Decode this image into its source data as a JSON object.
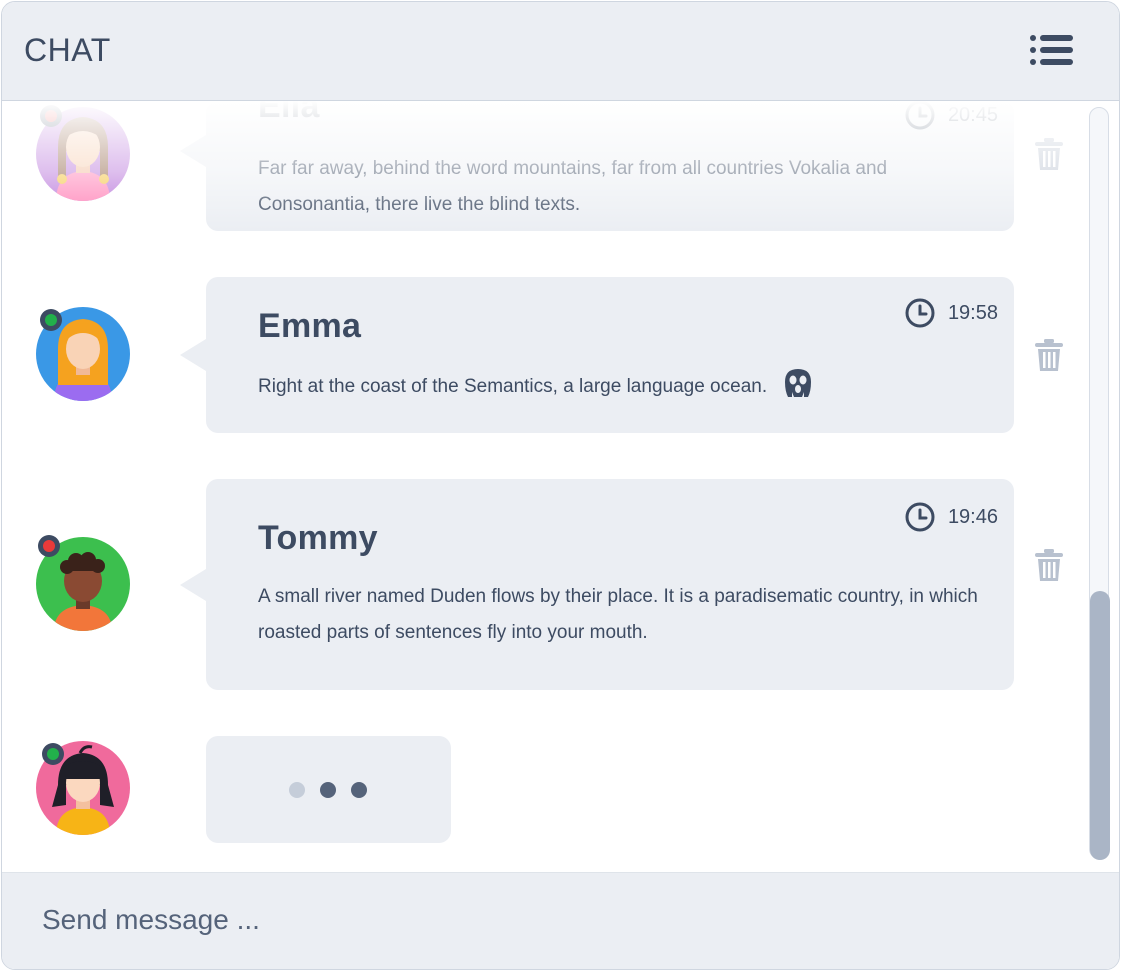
{
  "header": {
    "title": "CHAT",
    "menu_icon": "list-menu-icon"
  },
  "colors": {
    "header_bg": "#ebeef3",
    "bubble_bg": "#ebeef3",
    "text": "#3d4b62",
    "online": "#22b04b",
    "busy": "#e83a3a",
    "scrollbar_thumb": "#aab5c6"
  },
  "messages": [
    {
      "name": "Ella",
      "time": "20:45",
      "text": "Far far away, behind the word mountains, far from all countries Vokalia and Consonantia, there live the blind texts.",
      "status": "busy",
      "avatar_icon": "girl-braids-avatar"
    },
    {
      "name": "Emma",
      "time": "19:58",
      "text": "Right at the coast of the Semantics, a large language ocean.",
      "emoji_icon": "scream-face-icon",
      "status": "online",
      "avatar_icon": "girl-blonde-avatar"
    },
    {
      "name": "Tommy",
      "time": "19:46",
      "text": "A small river named Duden flows by their place. It is a paradisematic country, in which roasted parts of sentences fly into your mouth.",
      "status": "busy",
      "avatar_icon": "boy-curly-avatar"
    }
  ],
  "typing": {
    "status": "online",
    "avatar_icon": "girl-black-hair-avatar",
    "indicator": "typing-dots"
  },
  "composer": {
    "placeholder": "Send message ..."
  }
}
